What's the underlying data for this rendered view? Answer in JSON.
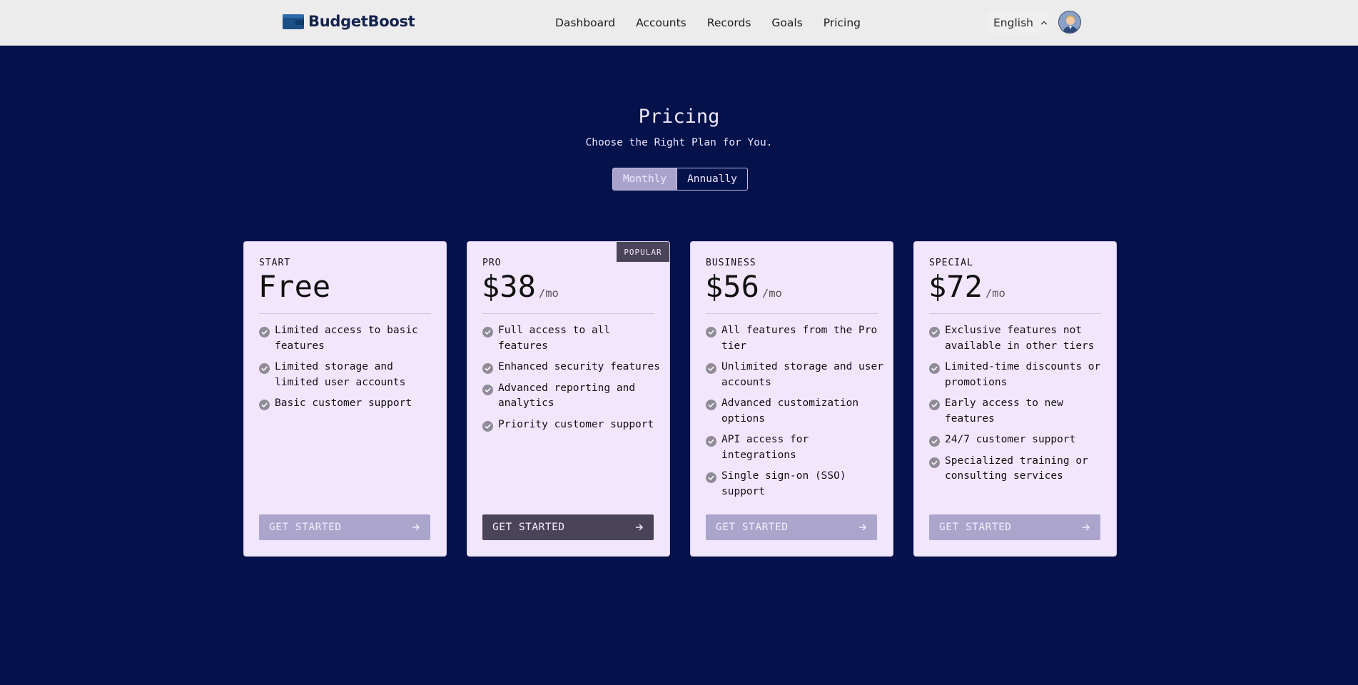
{
  "header": {
    "brand": "BudgetBoost",
    "nav": [
      "Dashboard",
      "Accounts",
      "Records",
      "Goals",
      "Pricing"
    ],
    "language": "English",
    "brand_color": "#1b4f86"
  },
  "hero": {
    "title": "Pricing",
    "subtitle": "Choose the Right Plan for You.",
    "toggle": {
      "selected": "Monthly",
      "options": [
        "Monthly",
        "Annually"
      ]
    }
  },
  "plans": [
    {
      "tier": "START",
      "price": "Free",
      "period": "",
      "badge": "",
      "features": [
        "Limited access to basic features",
        "Limited storage and limited user accounts",
        "Basic customer support"
      ],
      "cta": "GET STARTED"
    },
    {
      "tier": "PRO",
      "price": "$38",
      "period": "/mo",
      "badge": "POPULAR",
      "features": [
        "Full access to all features",
        "Enhanced security features",
        "Advanced reporting and analytics",
        "Priority customer support"
      ],
      "cta": "GET STARTED"
    },
    {
      "tier": "BUSINESS",
      "price": "$56",
      "period": "/mo",
      "badge": "",
      "features": [
        "All features from the Pro tier",
        "Unlimited storage and user accounts",
        "Advanced customization options",
        "API access for integrations",
        "Single sign-on (SSO) support"
      ],
      "cta": "GET STARTED"
    },
    {
      "tier": "SPECIAL",
      "price": "$72",
      "period": "/mo",
      "badge": "",
      "features": [
        "Exclusive features not available in other tiers",
        "Limited-time discounts or promotions",
        "Early access to new features",
        "24/7 customer support",
        "Specialized training or consulting services"
      ],
      "cta": "GET STARTED"
    }
  ]
}
